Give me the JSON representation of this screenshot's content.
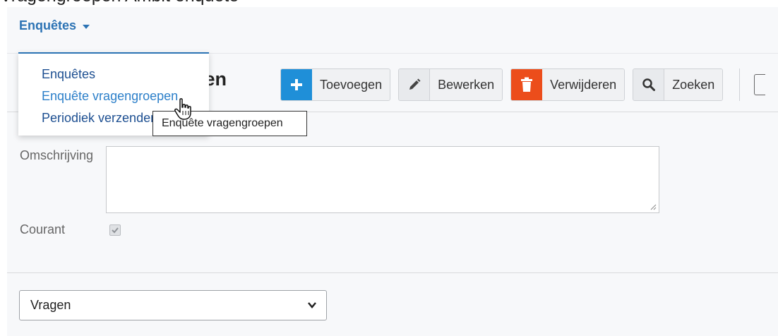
{
  "top_strip_text": "Vragengroepen Ambit enquête",
  "nav": {
    "menu_label": "Enquêtes"
  },
  "dropdown": {
    "items": [
      {
        "label": "Enquêtes"
      },
      {
        "label": "Enquête vragengroepen"
      },
      {
        "label": "Periodiek verzenden"
      }
    ]
  },
  "tooltip": "Enquête vragengroepen",
  "page": {
    "title_fragment": "epen"
  },
  "toolbar": {
    "add_label": "Toevoegen",
    "edit_label": "Bewerken",
    "delete_label": "Verwijderen",
    "search_label": "Zoeken"
  },
  "form": {
    "description_label": "Omschrijving",
    "description_value": "",
    "current_label": "Courant",
    "current_checked": true
  },
  "section_select": {
    "selected": "Vragen"
  },
  "colors": {
    "accent": "#2c73b4",
    "add_button": "#1f8fd8",
    "delete_button": "#ec4d1b"
  }
}
